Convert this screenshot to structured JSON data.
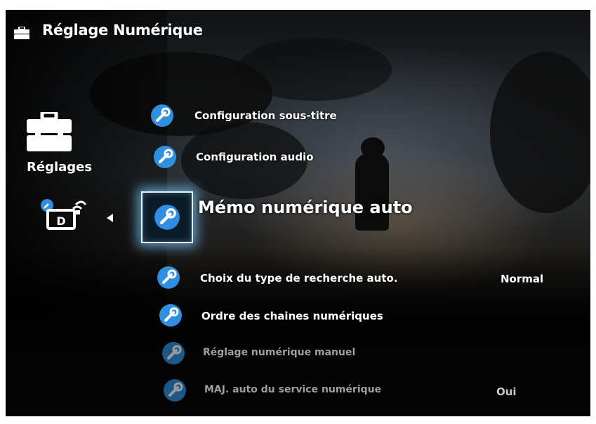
{
  "header": {
    "title": "Réglage Numérique",
    "icon": "toolbox-icon"
  },
  "sidebar": {
    "category_label": "Réglages",
    "category_icon": "toolbox-icon",
    "sub_icon": "digital-tv-settings-icon"
  },
  "menu": {
    "items": [
      {
        "label": "Configuration sous-titre",
        "icon": "wrench-icon",
        "state": "normal"
      },
      {
        "label": "Configuration audio",
        "icon": "wrench-icon",
        "state": "normal"
      },
      {
        "label": "Mémo numérique auto",
        "icon": "wrench-icon",
        "state": "selected"
      },
      {
        "label": "Choix du type de recherche auto.",
        "value": "Normal",
        "icon": "wrench-icon",
        "state": "normal"
      },
      {
        "label": "Ordre des chaines numériques",
        "icon": "wrench-icon",
        "state": "normal"
      },
      {
        "label": "Réglage numérique manuel",
        "icon": "wrench-icon",
        "state": "disabled"
      },
      {
        "label": "MAJ. auto du service numérique",
        "value": "Oui",
        "icon": "wrench-icon",
        "state": "disabled"
      }
    ]
  },
  "colors": {
    "accent": "#2f8fe0",
    "highlight_glow": "#78c8ff",
    "text": "#ffffff",
    "disabled_text": "#9aa0a6"
  }
}
